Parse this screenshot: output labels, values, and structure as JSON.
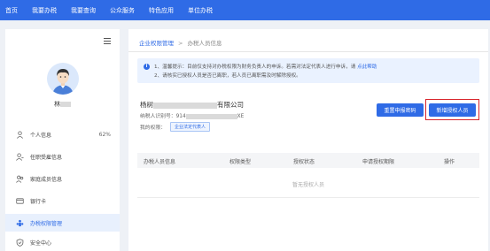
{
  "topnav": {
    "items": [
      "首页",
      "我要办税",
      "我要查询",
      "公众服务",
      "特色应用",
      "单位办税"
    ]
  },
  "sidebar": {
    "user_name": "林",
    "items": [
      {
        "label": "个人信息",
        "extra": "62%"
      },
      {
        "label": "任职受雇信息"
      },
      {
        "label": "家庭成员信息"
      },
      {
        "label": "银行卡"
      },
      {
        "label": "办税权限管理"
      },
      {
        "label": "安全中心"
      }
    ]
  },
  "breadcrumb": {
    "parent": "企业权限管理",
    "separator": ">",
    "current": "办税人员信息"
  },
  "notice": {
    "line1_text": "1、温馨提示：目前仅支持对办税权限为财务负责人的申诉。若需对法定代表人进行申诉，请",
    "line1_link": "点此帮助",
    "line2_text": "2、请核实已授权人员是否已离职，若人员已离职需及时解除授权。"
  },
  "company": {
    "name_prefix": "杨树",
    "name_suffix": "有限公司",
    "taxid_prefix": "纳税人识别号：914",
    "taxid_suffix": "XE",
    "role_label": "我的权限：",
    "role_tag": "企业法定代表人"
  },
  "buttons": {
    "reset_password": "重置申报密码",
    "add_authorized": "新增授权人员"
  },
  "table": {
    "headers": [
      "办税人员信息",
      "权限类型",
      "授权状态",
      "申请授权期限",
      "操作"
    ],
    "empty": "暂无授权人员"
  },
  "colors": {
    "primary": "#2f6be6",
    "highlight_border": "#d8262c"
  }
}
